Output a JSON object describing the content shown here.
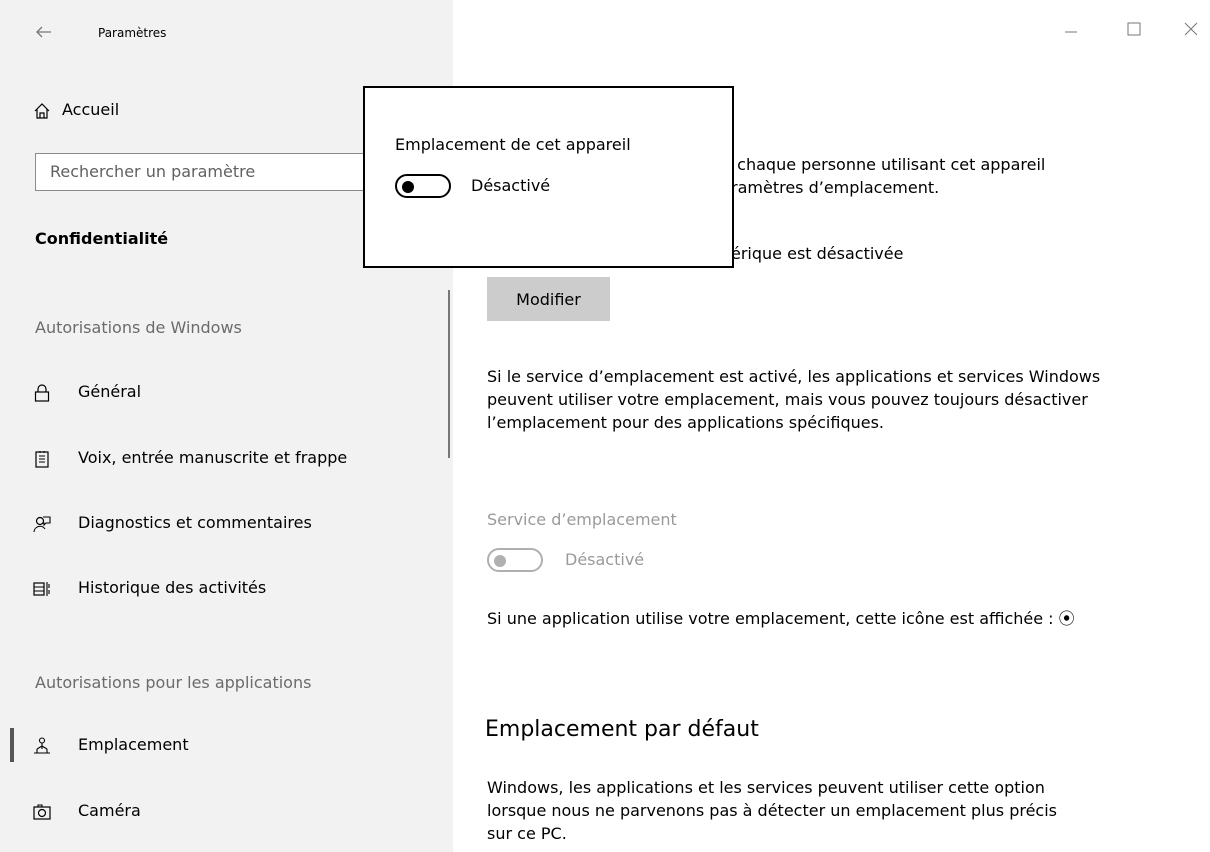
{
  "window": {
    "title": "Paramètres",
    "back_icon": "arrow-left-icon",
    "controls": {
      "minimize": "—",
      "maximize": "☐",
      "close": "✕"
    }
  },
  "sidebar": {
    "home_label": "Accueil",
    "search_placeholder": "Rechercher un paramètre",
    "section_title": "Confidentialité",
    "group1_header": "Autorisations de Windows",
    "items1": [
      {
        "label": "Général",
        "icon": "lock-icon"
      },
      {
        "label": "Voix, entrée manuscrite et frappe",
        "icon": "notepad-icon"
      },
      {
        "label": "Diagnostics et commentaires",
        "icon": "feedback-icon"
      },
      {
        "label": "Historique des activités",
        "icon": "timeline-icon"
      }
    ],
    "group2_header": "Autorisations pour les applications",
    "items2": [
      {
        "label": "Emplacement",
        "icon": "location-person-icon",
        "selected": true
      },
      {
        "label": "Caméra",
        "icon": "camera-icon"
      }
    ]
  },
  "main": {
    "partial_line1": ", chaque personne utilisant cet appareil",
    "partial_line2": "ramètres d’emplacement.",
    "partial_line3": "érique est désactivée",
    "modify_button": "Modifier",
    "para1": "Si le service d’emplacement est activé, les applications et services Windows peuvent utiliser votre emplacement, mais vous pouvez toujours désactiver l’emplacement pour des applications spécifiques.",
    "service_label": "Service d’emplacement",
    "service_toggle_label": "Désactivé",
    "para2": "Si une application utilise votre emplacement, cette icône est affichée :",
    "para2_icon": "⦿",
    "heading_default": "Emplacement par défaut",
    "para3": "Windows, les applications et les services peuvent utiliser cette option lorsque nous ne parvenons pas à détecter un emplacement plus précis sur ce PC."
  },
  "popup": {
    "title": "Emplacement de cet appareil",
    "toggle_label": "Désactivé"
  },
  "colors": {
    "sidebar_bg": "#f2f2f2",
    "button_bg": "#cccccc",
    "disabled": "#9a9a9a"
  }
}
